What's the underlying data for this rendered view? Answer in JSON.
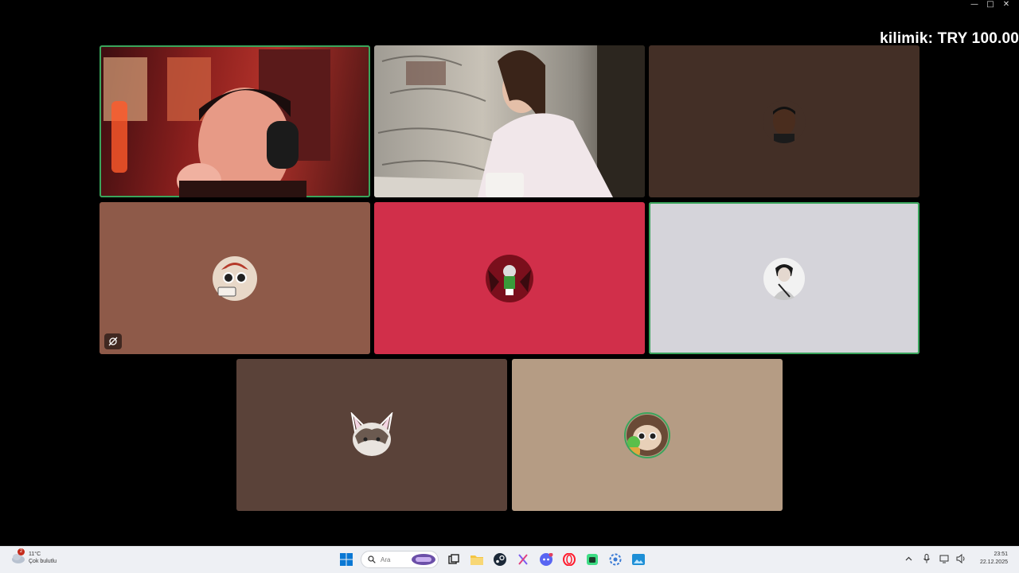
{
  "overlay": {
    "donation_text": "kilimik: TRY 100.00"
  },
  "window_controls": [
    "minimize-icon",
    "maximize-icon",
    "close-icon"
  ],
  "tiles": [
    {
      "id": "user-1",
      "kind": "camera",
      "speaking": true,
      "bg": "#7a1e1a"
    },
    {
      "id": "user-2",
      "kind": "camera",
      "speaking": false,
      "bg": "#8d8880"
    },
    {
      "id": "user-3",
      "kind": "avatar",
      "speaking": false,
      "bg": "#432f26"
    },
    {
      "id": "user-4",
      "kind": "avatar",
      "speaking": false,
      "muted": true,
      "bg": "#8e5a49"
    },
    {
      "id": "user-5",
      "kind": "avatar",
      "speaking": false,
      "bg": "#d12f4a"
    },
    {
      "id": "user-6",
      "kind": "avatar",
      "speaking": true,
      "bg": "#d5d4da"
    },
    {
      "id": "user-7",
      "kind": "avatar",
      "speaking": false,
      "bg": "#5a4239"
    },
    {
      "id": "user-8",
      "kind": "avatar",
      "speaking": false,
      "bg": "#b59c84"
    }
  ],
  "colors": {
    "speaking_ring": "#3aa55c",
    "taskbar": "#eef0f4"
  },
  "taskbar": {
    "weather": {
      "temp": "11°C",
      "condition": "Çok bulutlu",
      "badge": "2"
    },
    "search_placeholder": "Ara",
    "apps": [
      "start-icon",
      "task-view-icon",
      "file-explorer-icon",
      "steam-icon",
      "snipping-tool-icon",
      "discord-icon",
      "opera-icon",
      "android-icon",
      "settings-gear-icon",
      "photos-icon"
    ],
    "tray": [
      "chevron-up-icon",
      "microphone-icon",
      "network-icon",
      "volume-icon"
    ],
    "time": "23:51",
    "date": "22.12.2025"
  }
}
